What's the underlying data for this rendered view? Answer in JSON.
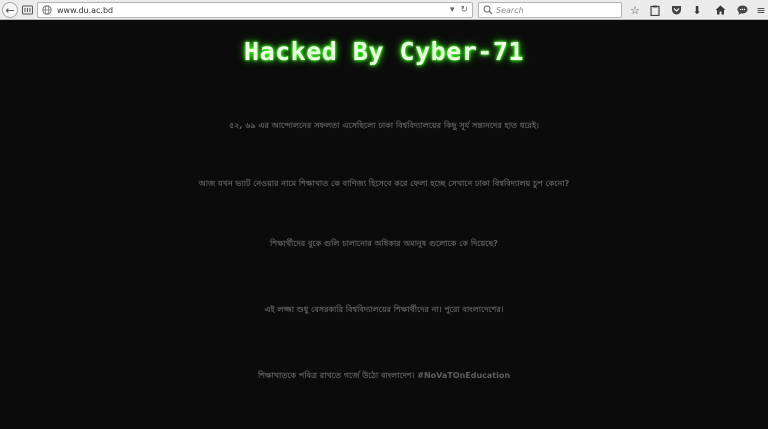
{
  "browser": {
    "url": "www.du.ac.bd",
    "search_placeholder": "Search"
  },
  "page": {
    "title": "Hacked By Cyber-71",
    "lines": [
      "৫২, ৬৯ এর আন্দোলনের সফলতা এসেছিলো ঢাকা বিশ্ববিদ্যালয়ের কিছু সূর্য সন্তানদের হাত ধরেই।",
      "আজ যখন ভ্যাট নেওয়ার নামে শিক্ষাখাত কে বাণিজ্য হিসেবে করে ফেলা হচ্ছে সেখানে ঢাকা বিশ্ববিদ্যালয় চুপ কেনো?",
      "শিক্ষার্থীদের বুকে গুলি চালানোর অধিকার অমানুষ গুলোকে কে দিয়েছে?",
      "এই লজ্জা শুধু বেসরকারি বিশ্ববিদ্যালয়ের শিক্ষার্থীদের না। পুরো বাংলাদেশের।",
      "শিক্ষাখাতকে পবিত্র রাখতে গর্জে উঠো বাংলাদেশ। #NoVaTOnEducation"
    ]
  },
  "colors": {
    "background": "#0b0b0b",
    "title_glow": "#33d915",
    "text": "#5f5f5f"
  }
}
